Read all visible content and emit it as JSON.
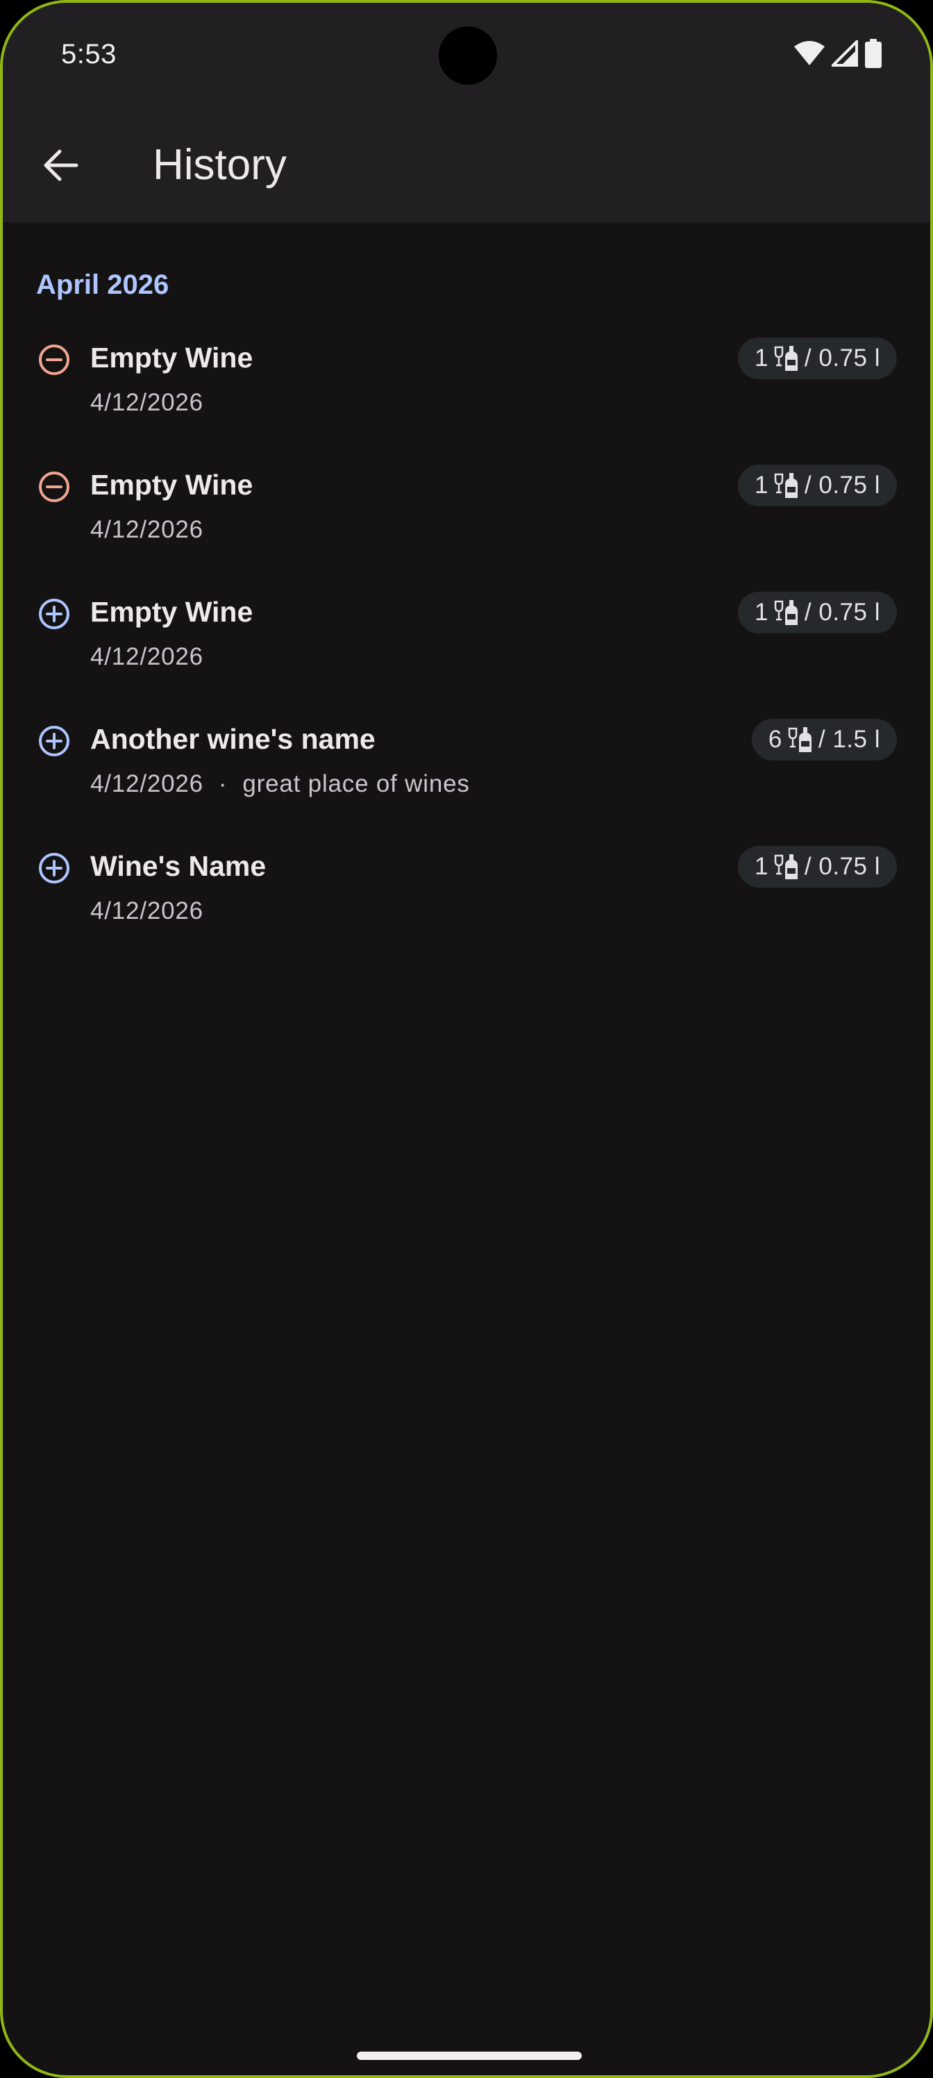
{
  "status_bar": {
    "time": "5:53"
  },
  "app_bar": {
    "title": "History"
  },
  "section": {
    "title": "April 2026"
  },
  "entries": [
    {
      "type": "remove",
      "name": "Empty Wine",
      "date": "4/12/2026",
      "place": "",
      "bottles": "1",
      "volume": "/ 0.75 l"
    },
    {
      "type": "remove",
      "name": "Empty Wine",
      "date": "4/12/2026",
      "place": "",
      "bottles": "1",
      "volume": "/ 0.75 l"
    },
    {
      "type": "add",
      "name": "Empty Wine",
      "date": "4/12/2026",
      "place": "",
      "bottles": "1",
      "volume": "/ 0.75 l"
    },
    {
      "type": "add",
      "name": "Another wine's name",
      "date": "4/12/2026",
      "place": "great place of wines",
      "bottles": "6",
      "volume": "/ 1.5 l"
    },
    {
      "type": "add",
      "name": "Wine's Name",
      "date": "4/12/2026",
      "place": "",
      "bottles": "1",
      "volume": "/ 0.75 l"
    }
  ],
  "icons": {
    "back": "arrow-back-icon",
    "remove": "minus-circle-icon",
    "add": "plus-circle-icon",
    "bottle": "wine-bottle-glass-icon"
  },
  "colors": {
    "remove": "#f2a591",
    "add": "#adc6ff",
    "section_header": "#adc6ff",
    "background": "#151214",
    "app_bar": "#211f21",
    "badge": "#25292c"
  }
}
